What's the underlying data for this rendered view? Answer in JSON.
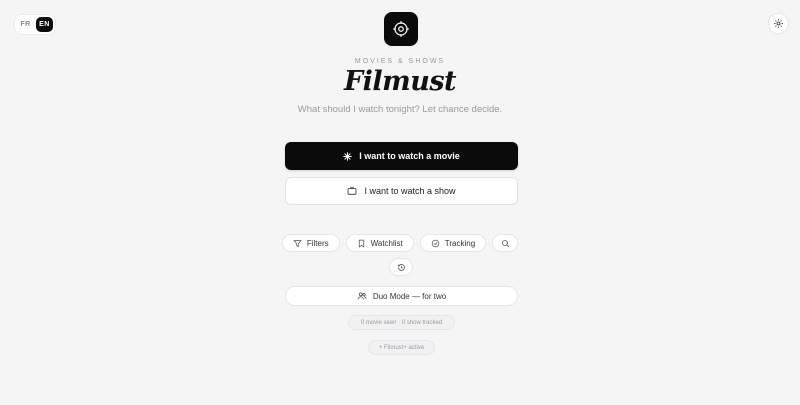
{
  "language": {
    "options": [
      "FR",
      "EN"
    ],
    "active": "EN"
  },
  "brand": {
    "kicker": "MOVIES & SHOWS",
    "title": "Filmust",
    "subtitle": "What should I watch tonight? Let chance decide."
  },
  "actions": {
    "movie_label": "I want to watch a movie",
    "show_label": "I want to watch a show"
  },
  "tools": {
    "filters": "Filters",
    "watchlist": "Watchlist",
    "tracking": "Tracking"
  },
  "duo": {
    "label": "Duo Mode — for two"
  },
  "stats": {
    "text": "0 movie seen · 0 show tracked"
  },
  "plus": {
    "text": "+ Filmust+ active"
  },
  "icons": {
    "logo": "film-reel-icon",
    "settings": "gear-icon",
    "movie": "sparkle-icon",
    "show": "tv-icon",
    "filters": "funnel-icon",
    "watchlist": "bookmark-icon",
    "tracking": "check-circle-icon",
    "search": "search-icon",
    "history": "history-icon",
    "duo": "users-icon"
  },
  "colors": {
    "background": "#f5f5f6",
    "primary": "#0b0b0b",
    "muted_text": "#9a9aa0"
  }
}
